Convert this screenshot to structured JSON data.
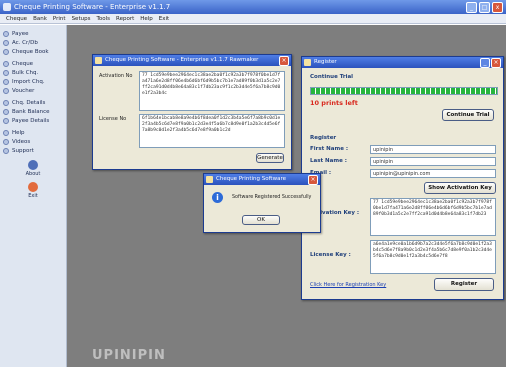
{
  "app": {
    "title": "Cheque Printing Software - Enterprise v1.1.7",
    "window_buttons": [
      "_",
      "□",
      "x"
    ]
  },
  "menu": [
    "Cheque",
    "Bank",
    "Print",
    "Setups",
    "Tools",
    "Report",
    "Help",
    "Exit"
  ],
  "sidebar": {
    "items": [
      "Payee",
      "Ac. Cr/Db",
      "Cheque Book",
      "Cheque",
      "Bulk Chq.",
      "Import Chq.",
      "Voucher",
      "Chq. Details",
      "Bank Balance",
      "Payee Details",
      "Help",
      "Videos",
      "Support"
    ],
    "about_label": "About",
    "exit_label": "Exit"
  },
  "activation_window": {
    "title": "Cheque Printing Software - Enterprise v1.1.7 Rawmaker",
    "activation_label": "Activation No",
    "activation_value": "77 1cd59e9bee2964ec1c38ae2ba0f1c92a3b7f978f0be1d7fa471a6e2d8ff06e4b6d6bf6d9b5bc7b1e7ad89f0b3d1a5c2e7ff2ca91d0d4b8e64a83c1f7db23ac9f1c2b3d4e5f6a7b8c9d0e1f2a3b4c",
    "license_label": "License No",
    "license_value": "6f1b64e1bcab8e8a9e4b6f8dea0f1d2c3b4a5e6f7a8b9c0d1e2f3a4b5c6d7e8f9a0b1c2d3e4f5a6b7c8d9e0f1a2b3c4d5e6f7a8b9c0d1e2f3a4b5c6d7e8f9a0b1c2d",
    "button_label": "Generate"
  },
  "message_box": {
    "title": "Cheque Printing Software",
    "message": "Software Registered Successfully",
    "ok_label": "OK"
  },
  "register_window": {
    "title": "Register",
    "trial_heading": "Continue Trial",
    "trial_progress": 1.0,
    "prints_left": "10 prints left",
    "continue_button": "Continue Trial",
    "register_heading": "Register",
    "first_name_label": "First Name :",
    "first_name_value": "upinipin",
    "last_name_label": "Last Name :",
    "last_name_value": "upinipin",
    "email_label": "Email :",
    "email_value": "upinipin@upinipin.com",
    "show_activation_button": "Show Activation Key",
    "activation_key_label": "Activation Key :",
    "activation_key_value": "77 1cd59e9bee2964ec1c38ae2ba0f1c92a3b7f978f0be1d7fa471a6e2d8ff06e4b6d6bf6d9b5bc7b1e7ad89f0b3d1a5c2e7ff2ca91d0d4b8e64a83c1f7db23",
    "license_key_label": "License Key :",
    "license_key_value": "a6e4a1e9ce0a1b6d9b7a2c3d4e5f6a7b8c9d0e1f2a3b4c5d6e7f8a9b0c1d2e3f4a5b6c7d8e9f0a1b2c3d4e5f6a7b8c9d0e1f2a3b4c5d6e7f8",
    "link_label": "Click Here for Registration Key",
    "register_button": "Register"
  },
  "branding": "UPINIPIN",
  "colors": {
    "titlebar": "#3a63c8",
    "workspace": "#7e7e7e",
    "progress": "#26b53d",
    "prints_left": "#d8281d"
  }
}
